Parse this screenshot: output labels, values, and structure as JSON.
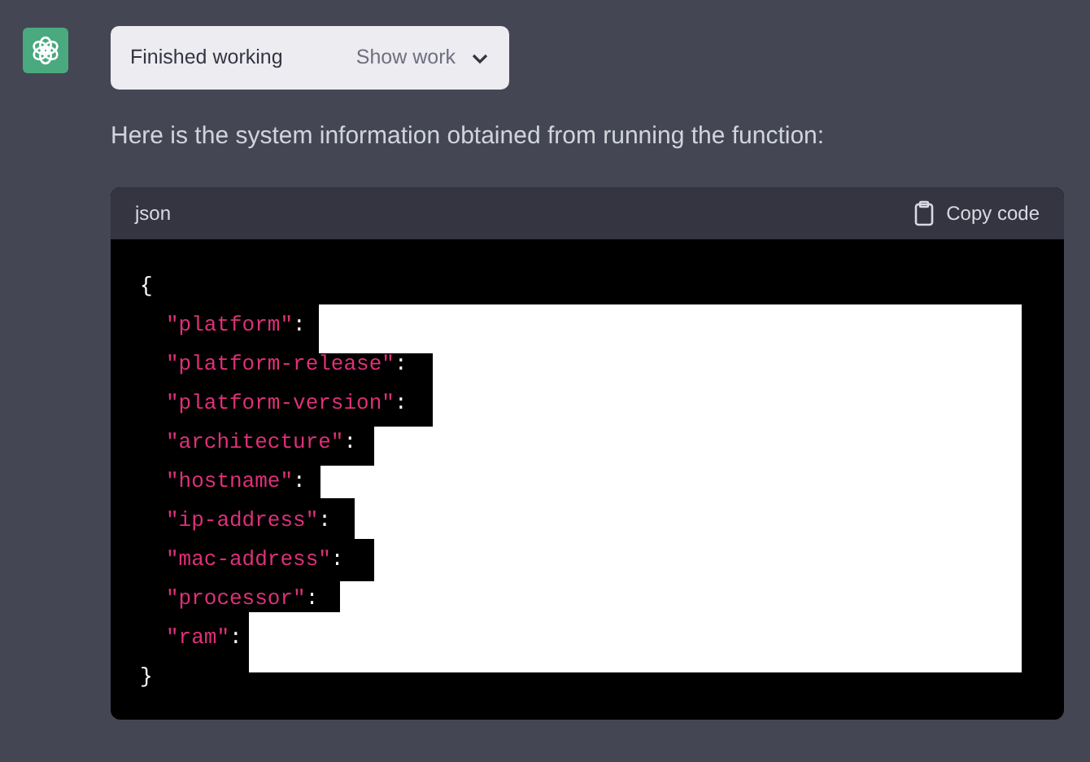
{
  "status_pill": {
    "label": "Finished working",
    "action": "Show work"
  },
  "message": "Here is the system information obtained from running the function:",
  "code_block": {
    "language": "json",
    "copy_label": "Copy code",
    "lines": [
      {
        "kind": "punct",
        "text": "{"
      },
      {
        "kind": "key",
        "text": "\"platform\"",
        "punct": ":"
      },
      {
        "kind": "key",
        "text": "\"platform-release\"",
        "punct": ":"
      },
      {
        "kind": "key",
        "text": "\"platform-version\"",
        "punct": ":"
      },
      {
        "kind": "key",
        "text": "\"architecture\"",
        "punct": ":"
      },
      {
        "kind": "key",
        "text": "\"hostname\"",
        "punct": ":"
      },
      {
        "kind": "key",
        "text": "\"ip-address\"",
        "punct": ":"
      },
      {
        "kind": "key",
        "text": "\"mac-address\"",
        "punct": ":"
      },
      {
        "kind": "key",
        "text": "\"processor\"",
        "punct": ":"
      },
      {
        "kind": "key",
        "text": "\"ram\"",
        "punct": ":"
      },
      {
        "kind": "punct",
        "text": "}"
      }
    ]
  }
}
